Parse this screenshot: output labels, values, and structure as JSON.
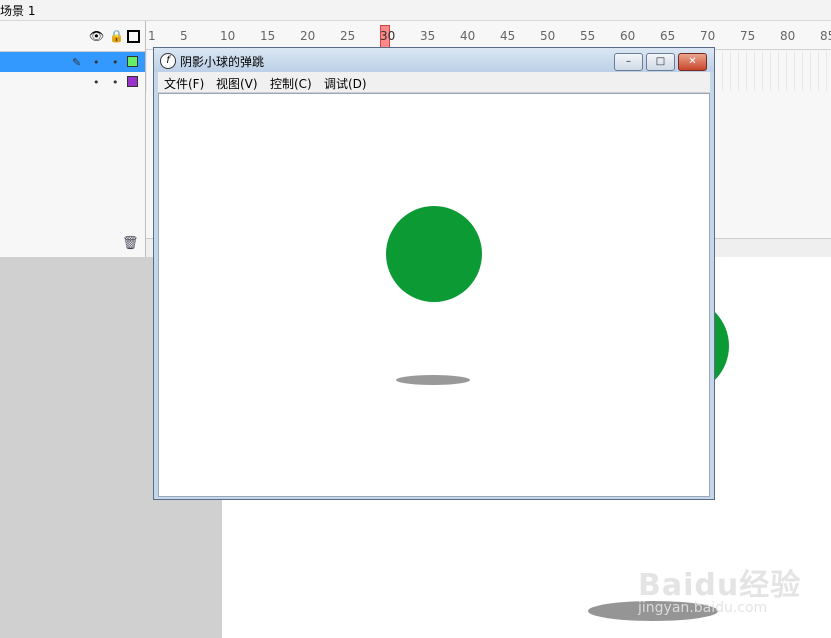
{
  "scene": {
    "label": "场景 1"
  },
  "layers": {
    "header_icons": [
      "eye-icon",
      "lock-icon",
      "outline-icon"
    ],
    "rows": [
      {
        "selected": true,
        "color": "#66ee66"
      },
      {
        "selected": false,
        "color": "#9933cc"
      }
    ]
  },
  "ruler": {
    "ticks": [
      "1",
      "5",
      "10",
      "15",
      "20",
      "25",
      "30",
      "35",
      "40",
      "45",
      "50",
      "55",
      "60",
      "65",
      "70",
      "75",
      "80",
      "85"
    ],
    "current_frame": "30"
  },
  "window": {
    "title": "阴影小球的弹跳",
    "menus": [
      "文件(F)",
      "视图(V)",
      "控制(C)",
      "调试(D)"
    ],
    "controls": {
      "minimize": "–",
      "restore": "□",
      "close": "✕"
    }
  },
  "colors": {
    "ball": "#0b9a34",
    "shadow": "#999999",
    "selection": "#3399ff",
    "stage_gray": "#d0d0d0"
  },
  "watermark": {
    "brand": "Baidu经验",
    "url": "jingyan.baidu.com"
  }
}
